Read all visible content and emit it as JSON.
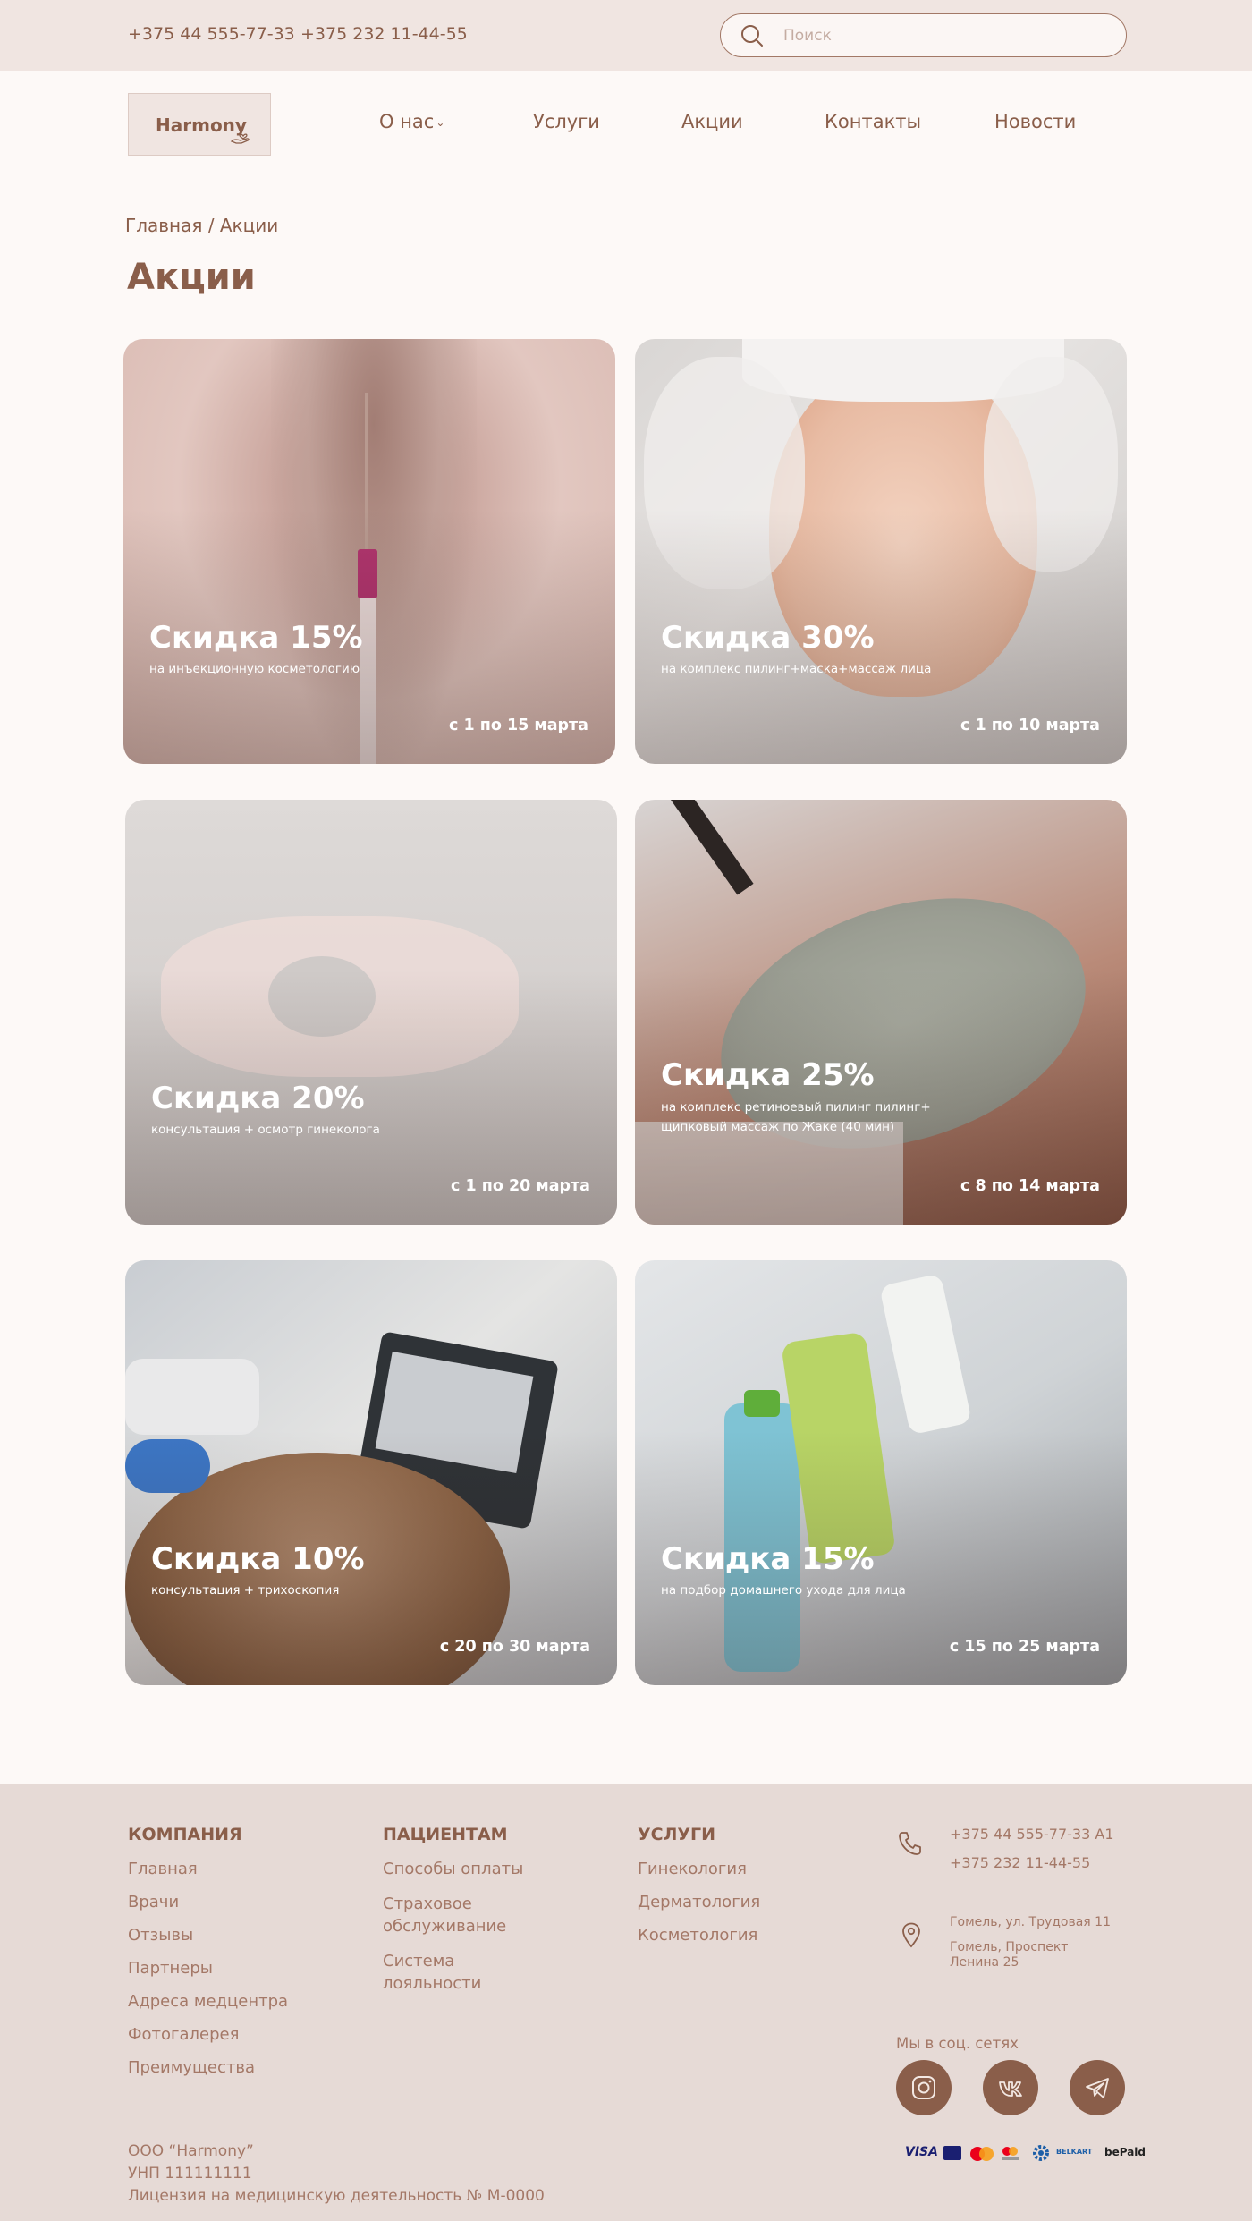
{
  "topbar": {
    "phone1": "+375 44 555-77-33",
    "phone2": "+375 232 11-44-55",
    "search_placeholder": "Поиск"
  },
  "header": {
    "logo_text": "Harmony",
    "nav": [
      "О нас",
      "Услуги",
      "Акции",
      "Контакты",
      "Новости"
    ]
  },
  "breadcrumb": {
    "home": "Главная",
    "separator": " / ",
    "current": "Акции"
  },
  "page_title": "Акции",
  "promos": [
    {
      "title": "Скидка 15%",
      "subtitle": "на инъекционную косметологию",
      "dates": "с 1 по 15 марта"
    },
    {
      "title": "Скидка 30%",
      "subtitle": "на комплекс пилинг+маска+массаж лица",
      "dates": "с 1 по 10 марта"
    },
    {
      "title": "Скидка 20%",
      "subtitle": "консультация + осмотр гинеколога",
      "dates": "с 1 по 20 марта"
    },
    {
      "title": "Скидка 25%",
      "subtitle": "на комплекс ретиноевый пилинг пилинг+ щипковый массаж по Жаке (40 мин)",
      "dates": "с 8 по 14 марта"
    },
    {
      "title": "Скидка 10%",
      "subtitle": "консультация + трихоскопия",
      "dates": "с 20 по 30 марта"
    },
    {
      "title": "Скидка 15%",
      "subtitle": "на подбор домашнего ухода для лица",
      "dates": "с 15 по 25 марта"
    }
  ],
  "footer": {
    "company": {
      "heading": "КОМПАНИЯ",
      "links": [
        "Главная",
        "Врачи",
        "Отзывы",
        "Партнеры",
        "Адреса медцентра",
        "Фотогалерея",
        "Преимущества"
      ]
    },
    "patients": {
      "heading": "ПАЦИЕНТАМ",
      "links": [
        "Способы оплаты",
        "Страховое обслуживание",
        "Система лояльности"
      ]
    },
    "services": {
      "heading": "УСЛУГИ",
      "links": [
        "Гинекология",
        "Дерматология",
        "Косметология"
      ]
    },
    "contacts": {
      "phone1": "+375 44 555-77-33 A1",
      "phone2": "+375 232 11-44-55",
      "address1": "Гомель, ул. Трудовая 11",
      "address2": "Гомель, Проспект Ленина 25"
    },
    "social_label": "Мы в соц. сетях",
    "legal": [
      "ООО “Harmony”",
      "УНП 111111111",
      "Лицензия на медицинскую деятельность № М-0000"
    ],
    "payments": [
      "VISA",
      "BELKART",
      "bePaid"
    ]
  },
  "colors": {
    "brand": "#8a5e4a",
    "topbar_bg": "#f0e5e1",
    "page_bg": "#fdf9f7",
    "footer_bg": "#e6dad6"
  }
}
